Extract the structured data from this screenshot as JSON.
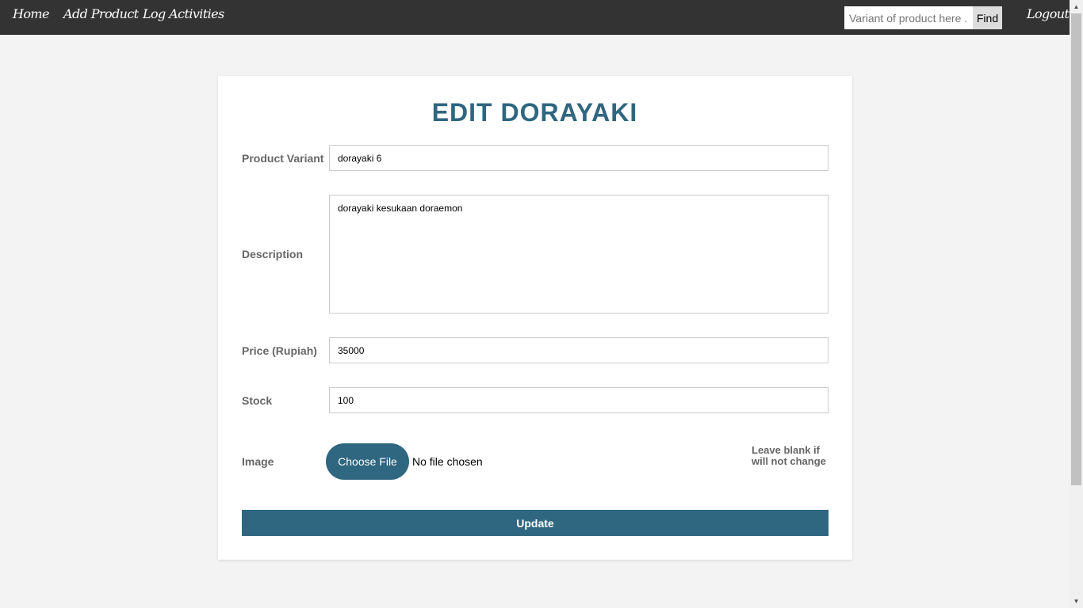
{
  "nav": {
    "home": "Home",
    "add_product": "Add Product",
    "log_activities": "Log Activities",
    "logout": "Logout",
    "search_placeholder": "Variant of product here ...",
    "find": "Find"
  },
  "form": {
    "title": "EDIT DORAYAKI",
    "variant_label": "Product Variant",
    "variant_value": "dorayaki 6",
    "description_label": "Description",
    "description_value": "dorayaki kesukaan doraemon",
    "price_label": "Price (Rupiah)",
    "price_value": "35000",
    "stock_label": "Stock",
    "stock_value": "100",
    "image_label": "Image",
    "choose_file": "Choose File",
    "no_file": "No file chosen",
    "image_hint": "Leave blank if will not change",
    "update": "Update"
  },
  "colors": {
    "navbar": "#333333",
    "accent": "#2f6680",
    "background": "#f3f3f3"
  }
}
